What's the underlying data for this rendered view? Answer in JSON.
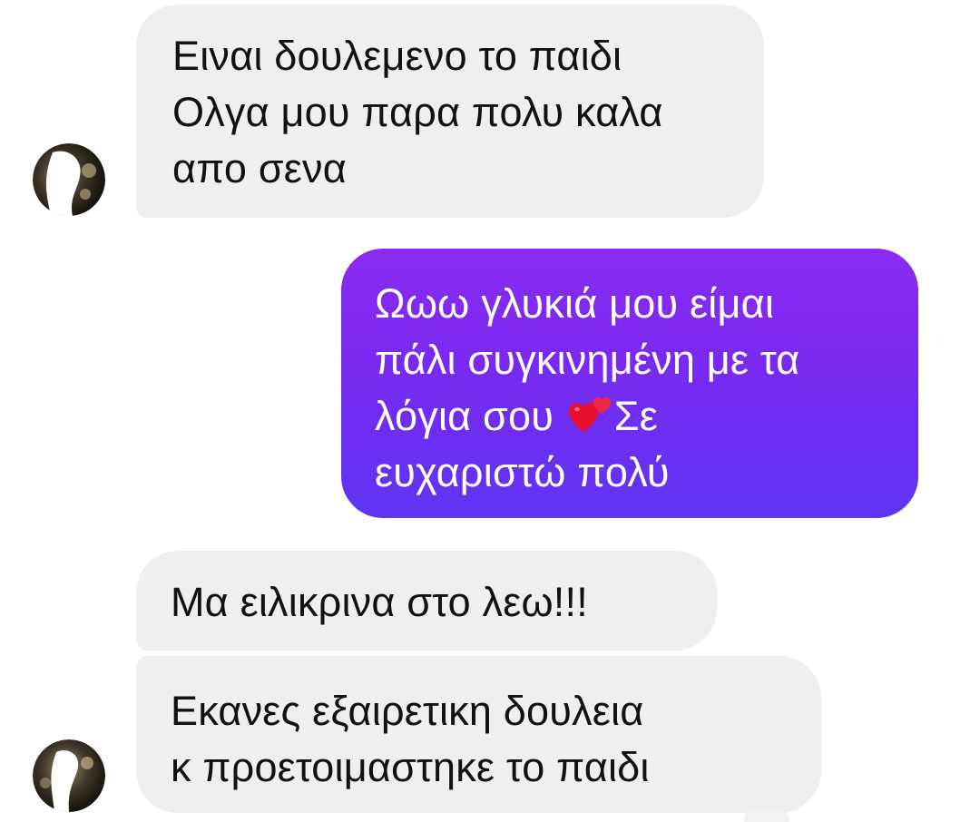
{
  "messages": [
    {
      "id": "b1",
      "direction": "incoming",
      "lines": [
        "Ειναι δουλεμενο το παιδι",
        "Ολγα μου παρα πολυ καλα",
        "απο σενα"
      ]
    },
    {
      "id": "b2",
      "direction": "outgoing",
      "lines": [
        "Ωωω γλυκιά μου είμαι",
        "πάλι συγκινημένη με τα",
        "λόγια σου ",
        "Σε",
        "ευχαριστώ πολύ"
      ],
      "emoji": "two-hearts-icon"
    },
    {
      "id": "b3",
      "direction": "incoming",
      "lines": [
        "Μα ειλικρινα στο λεω!!!"
      ]
    },
    {
      "id": "b4",
      "direction": "incoming",
      "lines": [
        "Εκανες εξαιρετικη δουλεια",
        "κ προετοιμαστηκε το παιδι"
      ]
    }
  ],
  "colors": {
    "incoming_bg": "#efefef",
    "incoming_text": "#111111",
    "outgoing_top": "#8a2bf2",
    "outgoing_bottom": "#5f34f2",
    "outgoing_text": "#ffffff",
    "heart": "#e8112d"
  }
}
